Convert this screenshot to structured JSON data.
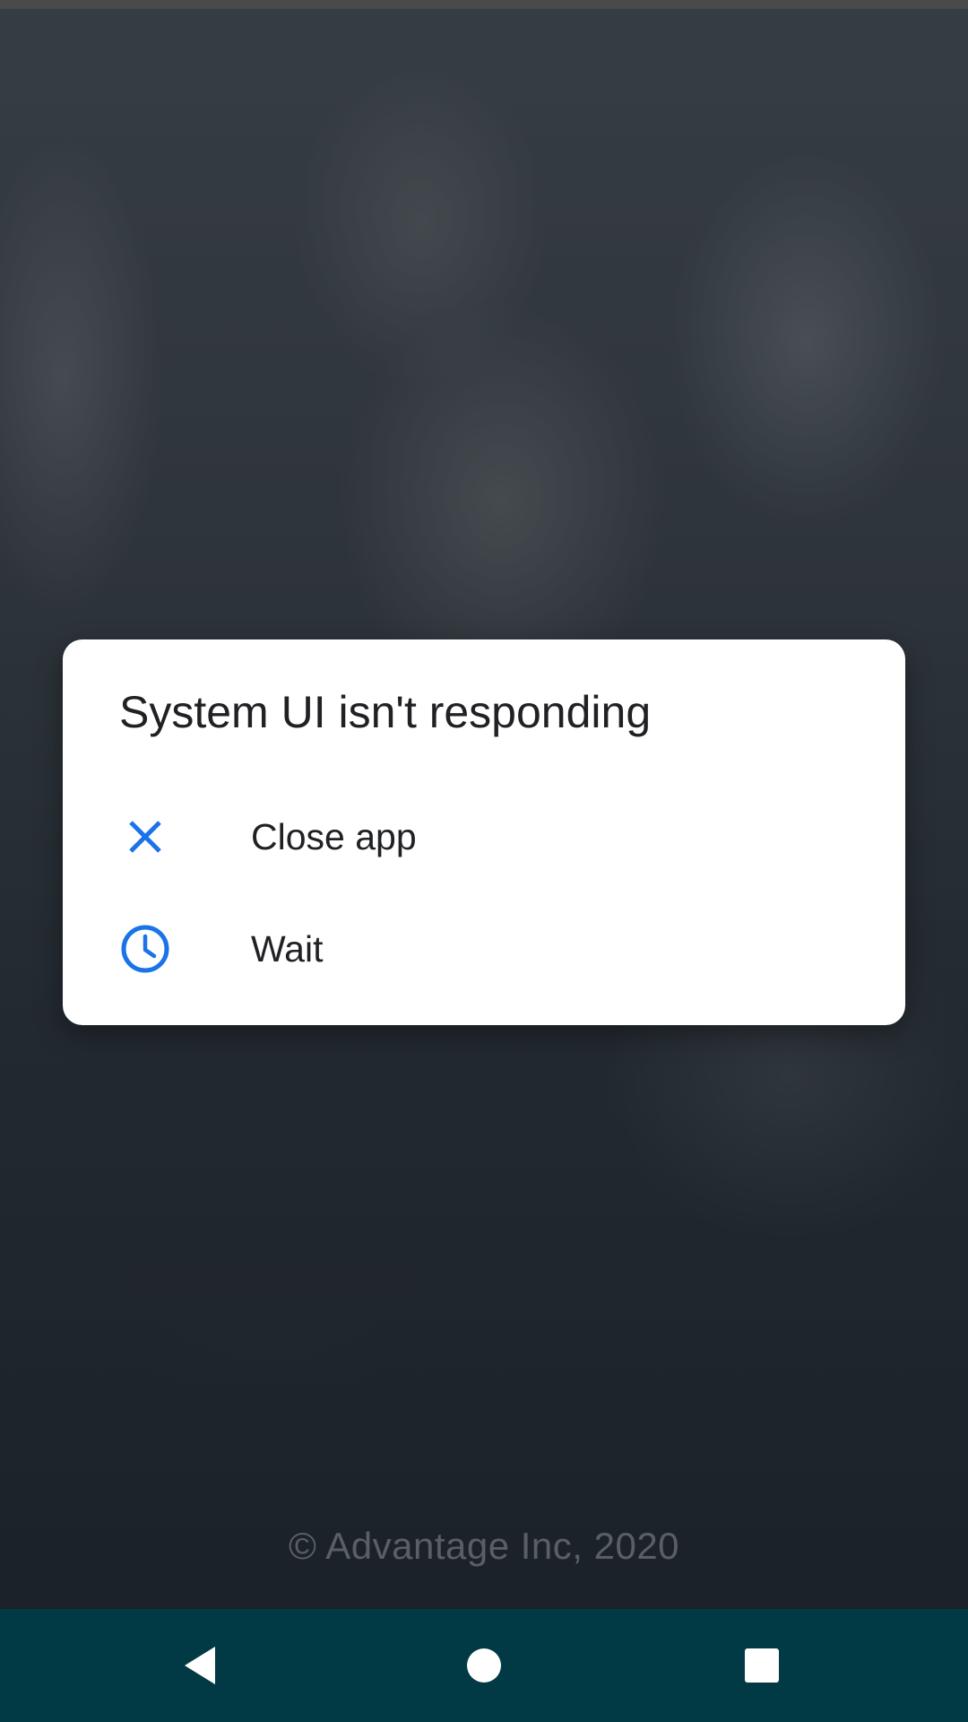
{
  "dialog": {
    "title": "System UI isn't responding",
    "options": [
      {
        "label": "Close app",
        "icon": "close-icon"
      },
      {
        "label": "Wait",
        "icon": "clock-icon"
      }
    ]
  },
  "background": {
    "copyright": "© Advantage Inc, 2020"
  },
  "navigation": {
    "buttons": [
      {
        "icon": "back-icon"
      },
      {
        "icon": "home-icon"
      },
      {
        "icon": "recents-icon"
      }
    ]
  },
  "colors": {
    "accent": "#1a73e8",
    "nav_bar": "#013a45",
    "dialog_bg": "#ffffff",
    "text_primary": "#202124"
  }
}
